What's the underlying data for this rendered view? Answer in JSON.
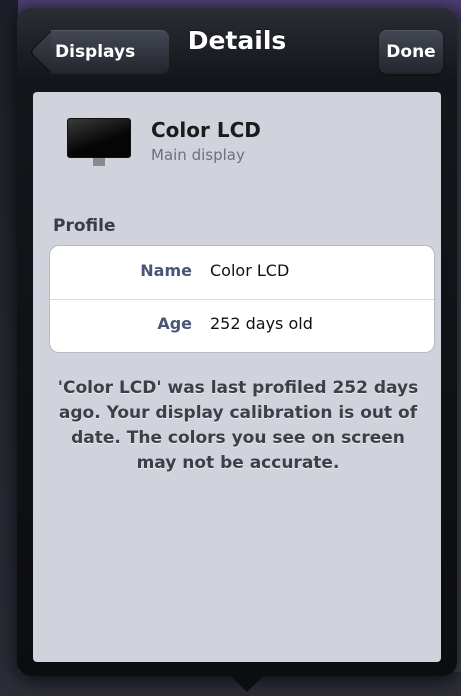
{
  "navbar": {
    "title": "Details",
    "back_label": "Displays",
    "done_label": "Done"
  },
  "device": {
    "name": "Color LCD",
    "subtitle": "Main display",
    "icon": "display-icon"
  },
  "profile": {
    "header": "Profile",
    "rows": [
      {
        "key": "Name",
        "value": "Color LCD"
      },
      {
        "key": "Age",
        "value": "252 days old"
      }
    ]
  },
  "message": "'Color LCD' was last profiled 252 days ago. Your display calibration is out of date. The colors you see on screen may not be accurate.",
  "colors": {
    "popover_dark": "#0c0d10",
    "content_bg": "#d1d3dc",
    "key_text": "#4a5679"
  }
}
